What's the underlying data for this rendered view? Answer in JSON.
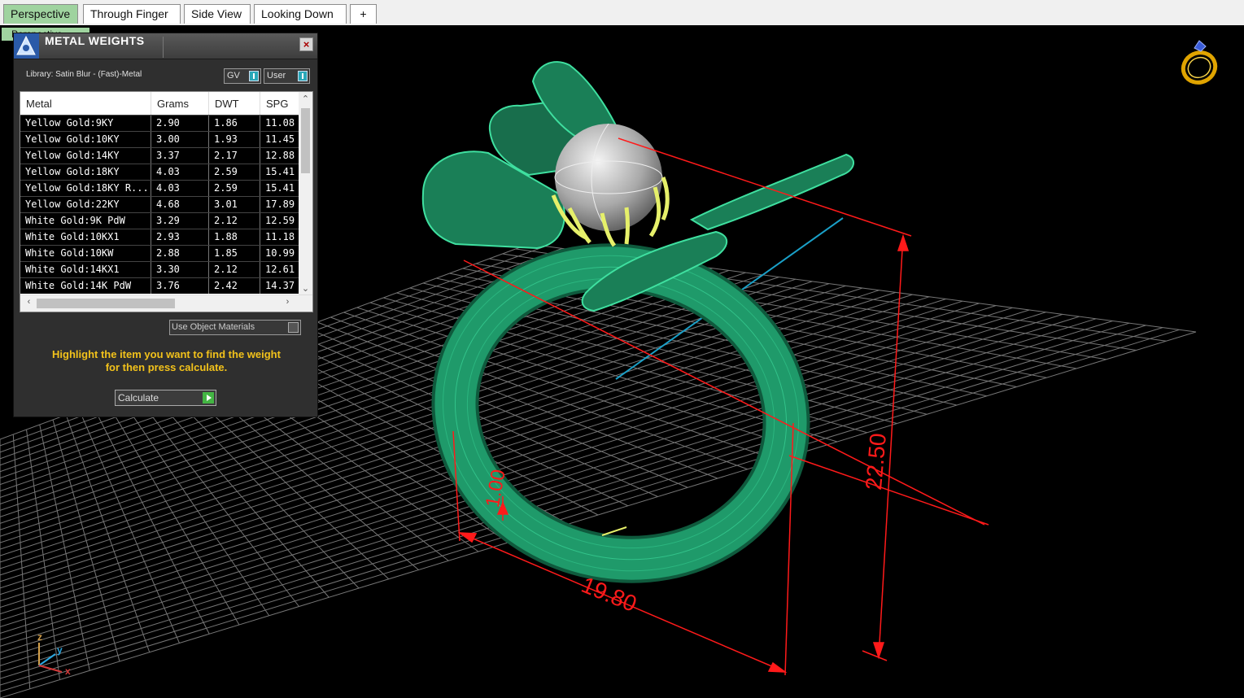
{
  "tabs": [
    {
      "label": "Perspective",
      "active": true
    },
    {
      "label": "Through Finger",
      "active": false
    },
    {
      "label": "Side View",
      "active": false
    },
    {
      "label": "Looking Down",
      "active": false
    },
    {
      "label": "+",
      "active": false
    }
  ],
  "viewport": {
    "label": "Perspective",
    "icons": {
      "navigation": "ring-icon",
      "axes": "axis-triad-icon"
    },
    "axes": {
      "z": "z",
      "y": "y",
      "x": "x"
    },
    "dimensions": {
      "width": "19.80",
      "height": "22.50",
      "thickness": "1.00"
    }
  },
  "panel": {
    "title": "METAL WEIGHTS",
    "close": "×",
    "library": "Library: Satin Blur - (Fast)-Metal",
    "toggle_gv": "GV",
    "toggle_user": "User",
    "columns": [
      "Metal",
      "Grams",
      "DWT",
      "SPG"
    ],
    "rows": [
      [
        "Yellow Gold:9KY",
        "2.90",
        "1.86",
        "11.08"
      ],
      [
        "Yellow Gold:10KY",
        "3.00",
        "1.93",
        "11.45"
      ],
      [
        "Yellow Gold:14KY",
        "3.37",
        "2.17",
        "12.88"
      ],
      [
        "Yellow Gold:18KY",
        "4.03",
        "2.59",
        "15.41"
      ],
      [
        "Yellow Gold:18KY R...",
        "4.03",
        "2.59",
        "15.41"
      ],
      [
        "Yellow Gold:22KY",
        "4.68",
        "3.01",
        "17.89"
      ],
      [
        "White Gold:9K PdW",
        "3.29",
        "2.12",
        "12.59"
      ],
      [
        "White Gold:10KX1",
        "2.93",
        "1.88",
        "11.18"
      ],
      [
        "White Gold:10KW",
        "2.88",
        "1.85",
        "10.99"
      ],
      [
        "White Gold:14KX1",
        "3.30",
        "2.12",
        "12.61"
      ],
      [
        "White Gold:14K PdW",
        "3.76",
        "2.42",
        "14.37"
      ]
    ],
    "use_object_materials": "Use Object Materials",
    "hint_line1": "Highlight the item you want to find the weight",
    "hint_line2": "for then press calculate.",
    "calculate": "Calculate"
  },
  "colors": {
    "ring": "#1f8a5f",
    "wire": "#3fe0a0",
    "prongs": "#e6f06a",
    "dimension": "#ff1a1a",
    "grid": "#8a8a8a",
    "accent_tab": "#9fd39f"
  }
}
